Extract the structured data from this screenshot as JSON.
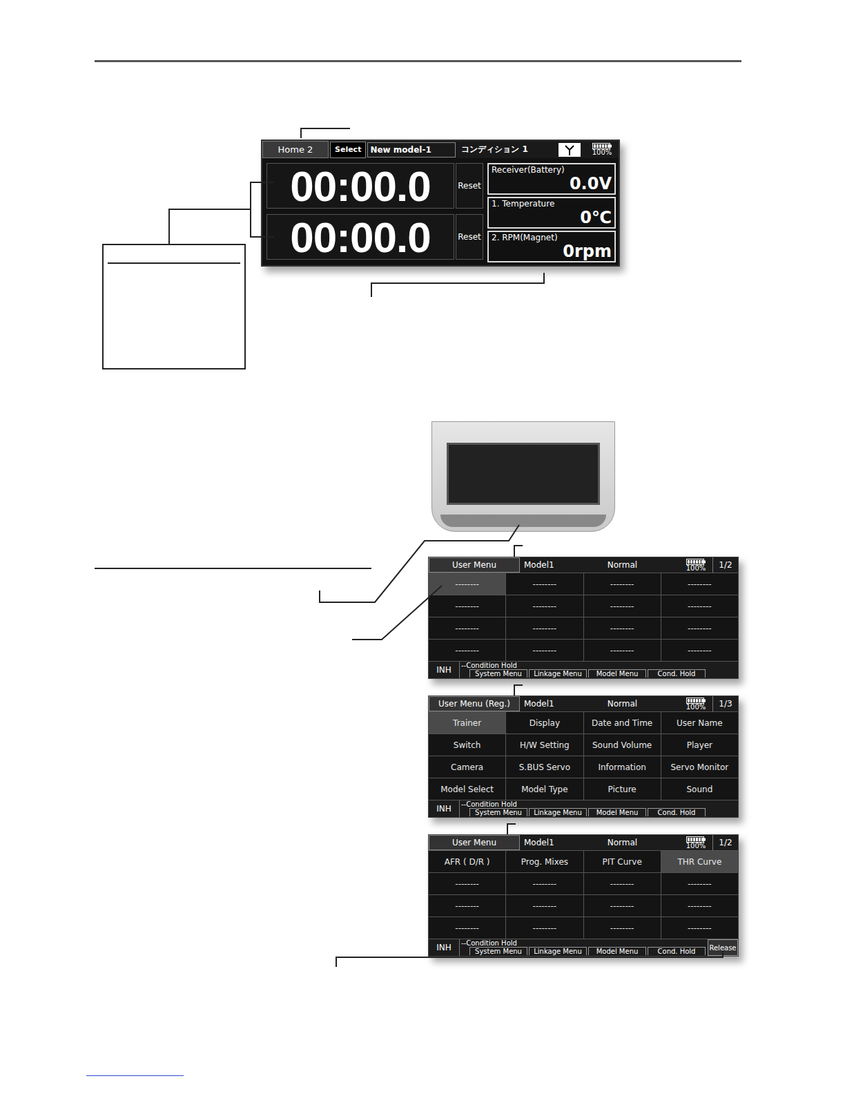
{
  "home2": {
    "tab": "Home 2",
    "select": "Select",
    "model": "New model-1",
    "condition": "コンディション 1",
    "battery": "100%",
    "timers": [
      {
        "time": "00:00.0",
        "reset": "Reset"
      },
      {
        "time": "00:00.0",
        "reset": "Reset"
      }
    ],
    "telemetry": [
      {
        "label": "Receiver(Battery)",
        "value": "0.0V"
      },
      {
        "label": "1. Temperature",
        "value": "0℃"
      },
      {
        "label": "2. RPM(Magnet)",
        "value": "0rpm"
      }
    ]
  },
  "menus": [
    {
      "title": "User Menu",
      "model": "Model1",
      "condition": "Normal",
      "battery": "100%",
      "page": "1/2",
      "inh": "INH",
      "hold": "--Condition Hold",
      "buttons": [
        "System Menu",
        "Linkage Menu",
        "Model Menu",
        "Cond. Hold"
      ],
      "release": "",
      "cells": [
        {
          "label": "--------",
          "selected": true
        },
        {
          "label": "--------",
          "selected": false
        },
        {
          "label": "--------",
          "selected": false
        },
        {
          "label": "--------",
          "selected": false
        },
        {
          "label": "--------",
          "selected": false
        },
        {
          "label": "--------",
          "selected": false
        },
        {
          "label": "--------",
          "selected": false
        },
        {
          "label": "--------",
          "selected": false
        },
        {
          "label": "--------",
          "selected": false
        },
        {
          "label": "--------",
          "selected": false
        },
        {
          "label": "--------",
          "selected": false
        },
        {
          "label": "--------",
          "selected": false
        },
        {
          "label": "--------",
          "selected": false
        },
        {
          "label": "--------",
          "selected": false
        },
        {
          "label": "--------",
          "selected": false
        },
        {
          "label": "--------",
          "selected": false
        }
      ]
    },
    {
      "title": "User Menu (Reg.)",
      "model": "Model1",
      "condition": "Normal",
      "battery": "100%",
      "page": "1/3",
      "inh": "INH",
      "hold": "--Condition Hold",
      "buttons": [
        "System Menu",
        "Linkage Menu",
        "Model Menu",
        "Cond. Hold"
      ],
      "release": "",
      "cells": [
        {
          "label": "Trainer",
          "selected": true
        },
        {
          "label": "Display",
          "selected": false
        },
        {
          "label": "Date and Time",
          "selected": false
        },
        {
          "label": "User Name",
          "selected": false
        },
        {
          "label": "Switch",
          "selected": false
        },
        {
          "label": "H/W Setting",
          "selected": false
        },
        {
          "label": "Sound Volume",
          "selected": false
        },
        {
          "label": "Player",
          "selected": false
        },
        {
          "label": "Camera",
          "selected": false
        },
        {
          "label": "S.BUS Servo",
          "selected": false
        },
        {
          "label": "Information",
          "selected": false
        },
        {
          "label": "Servo Monitor",
          "selected": false
        },
        {
          "label": "Model Select",
          "selected": false
        },
        {
          "label": "Model Type",
          "selected": false
        },
        {
          "label": "Picture",
          "selected": false
        },
        {
          "label": "Sound",
          "selected": false
        }
      ]
    },
    {
      "title": "User Menu",
      "model": "Model1",
      "condition": "Normal",
      "battery": "100%",
      "page": "1/2",
      "inh": "INH",
      "hold": "--Condition Hold",
      "buttons": [
        "System Menu",
        "Linkage Menu",
        "Model Menu",
        "Cond. Hold"
      ],
      "release": "Release",
      "cells": [
        {
          "label": "AFR ( D/R )",
          "selected": false
        },
        {
          "label": "Prog. Mixes",
          "selected": false
        },
        {
          "label": "PIT Curve",
          "selected": false
        },
        {
          "label": "THR Curve",
          "selected": true
        },
        {
          "label": "--------",
          "selected": false
        },
        {
          "label": "--------",
          "selected": false
        },
        {
          "label": "--------",
          "selected": false
        },
        {
          "label": "--------",
          "selected": false
        },
        {
          "label": "--------",
          "selected": false
        },
        {
          "label": "--------",
          "selected": false
        },
        {
          "label": "--------",
          "selected": false
        },
        {
          "label": "--------",
          "selected": false
        },
        {
          "label": "--------",
          "selected": false
        },
        {
          "label": "--------",
          "selected": false
        },
        {
          "label": "--------",
          "selected": false
        },
        {
          "label": "--------",
          "selected": false
        }
      ]
    }
  ]
}
